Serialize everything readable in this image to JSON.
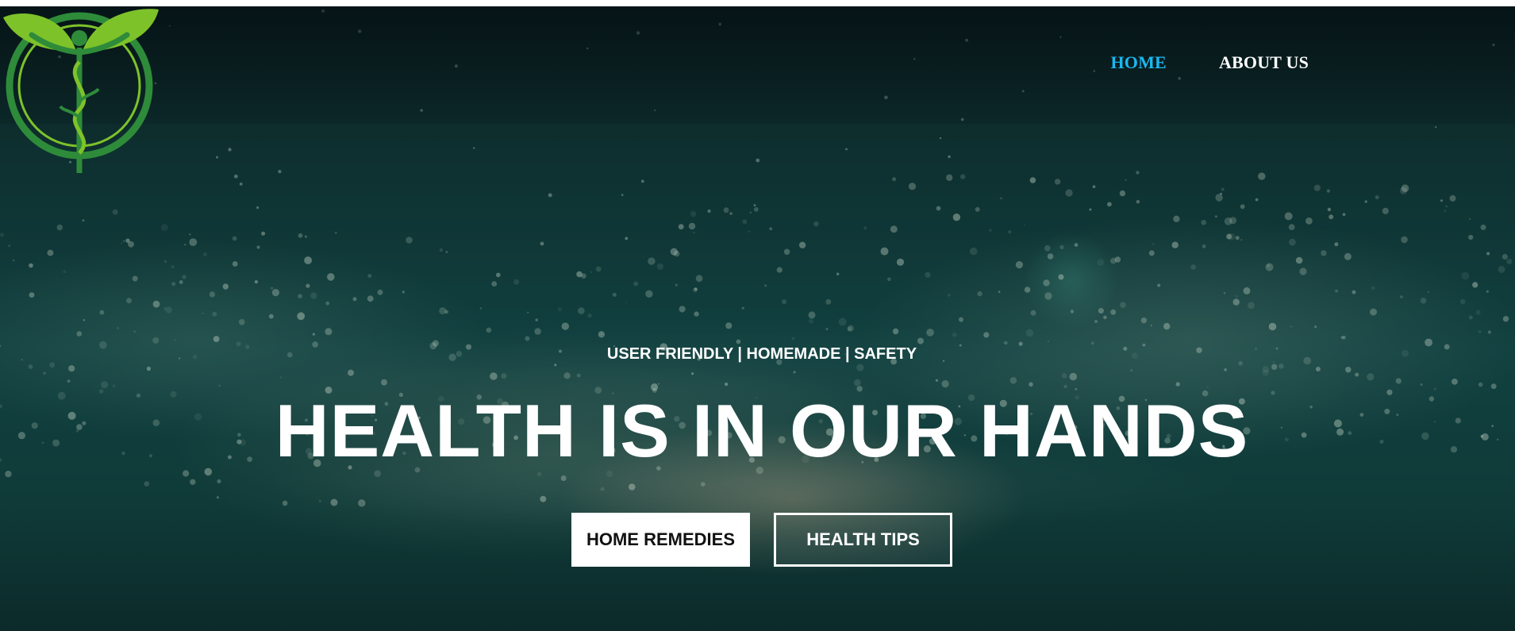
{
  "nav": {
    "items": [
      {
        "label": "HOME",
        "active": true
      },
      {
        "label": "ABOUT US",
        "active": false
      }
    ],
    "active_color": "#1ab8f0"
  },
  "hero": {
    "tagline": "USER FRIENDLY | HOMEMADE | SAFETY",
    "headline": "HEALTH IS IN OUR HANDS",
    "buttons": {
      "primary_label": "HOME REMEDIES",
      "secondary_label": "HEALTH TIPS"
    }
  },
  "logo": {
    "icon": "caduceus-figure-with-leaves-logo",
    "colors": {
      "dark_green": "#2e8b3a",
      "light_green": "#7ec22a"
    }
  }
}
